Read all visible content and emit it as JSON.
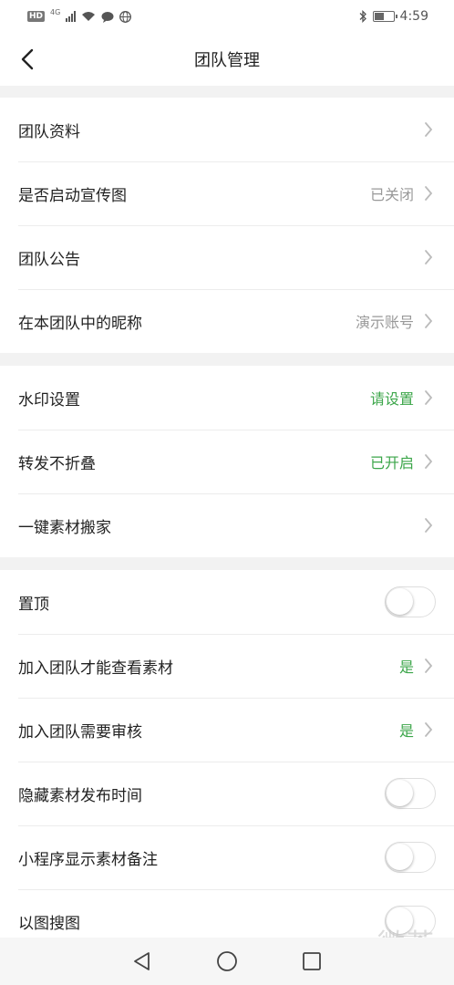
{
  "status_bar": {
    "hd": "HD",
    "network": "4G",
    "time": "4:59",
    "battery_level": 0.5
  },
  "header": {
    "title": "团队管理"
  },
  "section1": {
    "items": [
      {
        "label": "团队资料",
        "value": ""
      },
      {
        "label": "是否启动宣传图",
        "value": "已关闭"
      },
      {
        "label": "团队公告",
        "value": ""
      },
      {
        "label": "在本团队中的昵称",
        "value": "演示账号"
      }
    ]
  },
  "section2": {
    "items": [
      {
        "label": "水印设置",
        "value": "请设置"
      },
      {
        "label": "转发不折叠",
        "value": "已开启"
      },
      {
        "label": "一键素材搬家",
        "value": ""
      }
    ]
  },
  "section3": {
    "items": [
      {
        "label": "置顶",
        "toggle": false
      },
      {
        "label": "加入团队才能查看素材",
        "value": "是"
      },
      {
        "label": "加入团队需要审核",
        "value": "是"
      },
      {
        "label": "隐藏素材发布时间",
        "toggle": false
      },
      {
        "label": "小程序显示素材备注",
        "toggle": false
      },
      {
        "label": "以图搜图",
        "toggle": false
      }
    ]
  },
  "watermark": "微茶",
  "colors": {
    "accent_green": "#3ca64a",
    "muted_value": "#999999",
    "background": "#f2f2f2"
  }
}
